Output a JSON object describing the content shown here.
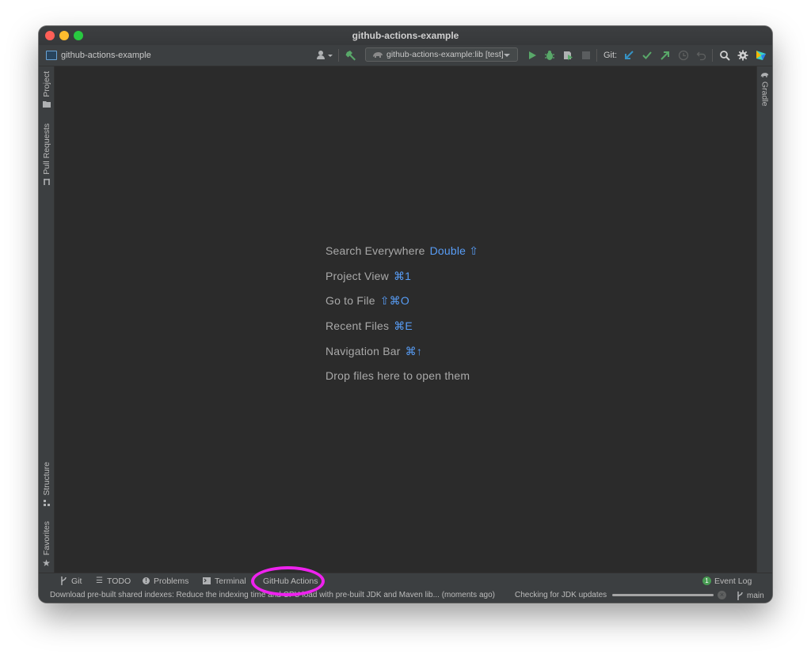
{
  "window": {
    "title": "github-actions-example"
  },
  "toolbar": {
    "project_name": "github-actions-example",
    "run_config": "github-actions-example:lib [test]",
    "git_label": "Git:"
  },
  "left_tool_windows": [
    "Project",
    "Pull Requests",
    "Structure",
    "Favorites"
  ],
  "right_tool_windows": [
    "Gradle"
  ],
  "editor": {
    "hints": [
      {
        "text": "Search Everywhere",
        "shortcut": "Double ⇧"
      },
      {
        "text": "Project View",
        "shortcut": "⌘1"
      },
      {
        "text": "Go to File",
        "shortcut": "⇧⌘O"
      },
      {
        "text": "Recent Files",
        "shortcut": "⌘E"
      },
      {
        "text": "Navigation Bar",
        "shortcut": "⌘↑"
      },
      {
        "text": "Drop files here to open them",
        "shortcut": ""
      }
    ]
  },
  "bottom_tabs": {
    "git": "Git",
    "todo": "TODO",
    "problems": "Problems",
    "terminal": "Terminal",
    "github_actions": "GitHub Actions",
    "event_log": "Event Log",
    "event_log_count": "1"
  },
  "status_bar": {
    "message": "Download pre-built shared indexes: Reduce the indexing time and CPU load with pre-built JDK and Maven lib... (moments ago)",
    "task": "Checking for JDK updates",
    "progress": 1.0,
    "branch": "main"
  },
  "colors": {
    "editor_bg": "#2b2b2b",
    "chrome_bg": "#3c3f41",
    "shortcut_blue": "#589df6",
    "run_green": "#59a869",
    "highlight_magenta": "#ee22ee"
  }
}
